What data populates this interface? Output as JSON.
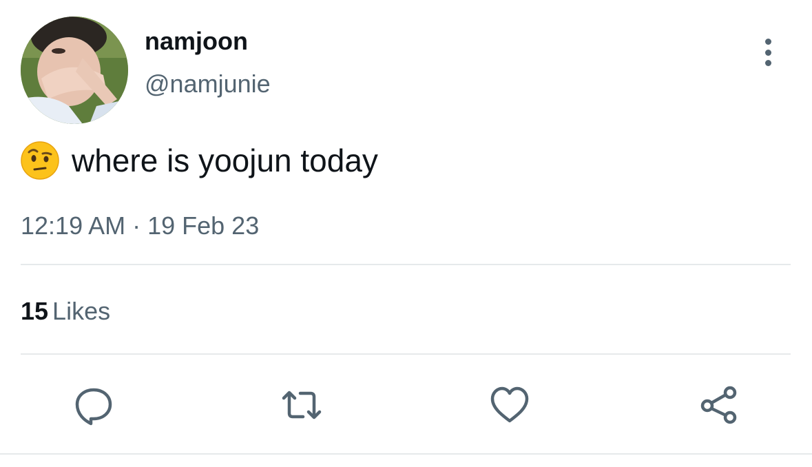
{
  "tweet": {
    "display_name": "namjoon",
    "handle": "@namjunie",
    "text": "where is yoojun today",
    "emoji_icon": "face-with-raised-eyebrow-icon",
    "timestamp": "12:19 AM · 19 Feb 23",
    "likes_count": "15",
    "likes_label": "Likes"
  },
  "actions": [
    {
      "icon": "reply-icon"
    },
    {
      "icon": "retweet-icon"
    },
    {
      "icon": "heart-icon"
    },
    {
      "icon": "share-icon"
    }
  ],
  "colors": {
    "text_primary": "#0f1419",
    "text_secondary": "#536471",
    "divider": "#e6e9eb",
    "icon": "#536471"
  }
}
